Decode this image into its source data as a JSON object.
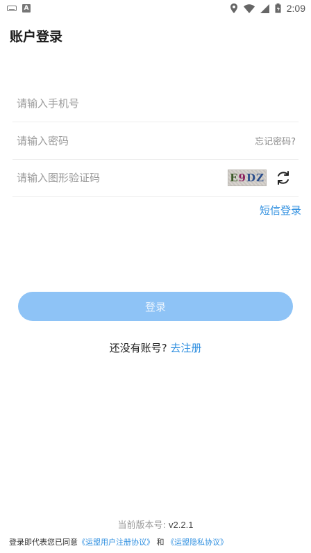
{
  "status_bar": {
    "time": "2:09"
  },
  "page": {
    "title": "账户登录"
  },
  "form": {
    "phone_placeholder": "请输入手机号",
    "password_placeholder": "请输入密码",
    "forgot_password": "忘记密码?",
    "captcha_placeholder": "请输入图形验证码",
    "captcha_chars": [
      "E",
      "9",
      "DZ"
    ],
    "sms_login": "短信登录"
  },
  "actions": {
    "login_label": "登录",
    "no_account_text": "还没有账号?",
    "register_label": "去注册"
  },
  "footer": {
    "version_label": "当前版本号:",
    "version_number": "v2.2.1",
    "agreement_prefix": "登录即代表您已同意",
    "user_agreement": "《运盟用户注册协议》",
    "and_text": "和",
    "privacy_agreement": "《运盟隐私协议》"
  },
  "colors": {
    "accent": "#2f8fe0",
    "button_bg": "#8ec3f6"
  },
  "icons": [
    "keyboard-icon",
    "a-notification-icon",
    "location-icon",
    "wifi-icon",
    "signal-icon",
    "battery-icon",
    "refresh-icon"
  ]
}
